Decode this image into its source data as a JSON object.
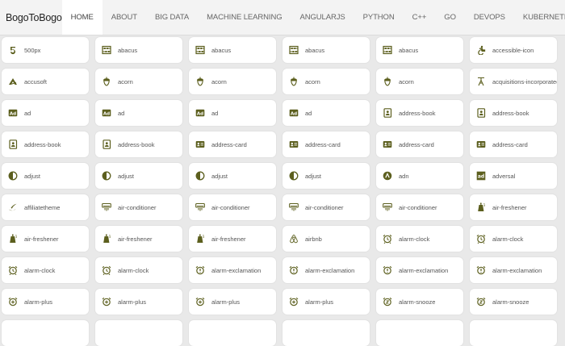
{
  "brand": "BogoToBogo",
  "nav": [
    {
      "label": "HOME",
      "active": true
    },
    {
      "label": "ABOUT"
    },
    {
      "label": "BIG DATA"
    },
    {
      "label": "MACHINE LEARNING"
    },
    {
      "label": "ANGULARJS"
    },
    {
      "label": "PYTHON"
    },
    {
      "label": "C++"
    },
    {
      "label": "GO"
    },
    {
      "label": "DEVOPS"
    },
    {
      "label": "KUBERNETES"
    }
  ],
  "icon_color": "#5c5f1e",
  "icons": [
    {
      "label": "500px",
      "icon": "500px-icon"
    },
    {
      "label": "abacus",
      "icon": "abacus-icon"
    },
    {
      "label": "abacus",
      "icon": "abacus-icon"
    },
    {
      "label": "abacus",
      "icon": "abacus-icon"
    },
    {
      "label": "abacus",
      "icon": "abacus-icon"
    },
    {
      "label": "accessible-icon",
      "icon": "accessible-icon"
    },
    {
      "label": "accusoft",
      "icon": "accusoft-icon"
    },
    {
      "label": "acorn",
      "icon": "acorn-icon"
    },
    {
      "label": "acorn",
      "icon": "acorn-icon"
    },
    {
      "label": "acorn",
      "icon": "acorn-icon"
    },
    {
      "label": "acorn",
      "icon": "acorn-icon"
    },
    {
      "label": "acquisitions-incorporated",
      "icon": "acquisitions-incorporated-icon"
    },
    {
      "label": "ad",
      "icon": "ad-icon"
    },
    {
      "label": "ad",
      "icon": "ad-icon"
    },
    {
      "label": "ad",
      "icon": "ad-icon"
    },
    {
      "label": "ad",
      "icon": "ad-icon"
    },
    {
      "label": "address-book",
      "icon": "address-book-icon"
    },
    {
      "label": "address-book",
      "icon": "address-book-icon"
    },
    {
      "label": "address-book",
      "icon": "address-book-icon"
    },
    {
      "label": "address-book",
      "icon": "address-book-icon"
    },
    {
      "label": "address-card",
      "icon": "address-card-icon"
    },
    {
      "label": "address-card",
      "icon": "address-card-icon"
    },
    {
      "label": "address-card",
      "icon": "address-card-icon"
    },
    {
      "label": "address-card",
      "icon": "address-card-icon"
    },
    {
      "label": "adjust",
      "icon": "adjust-icon"
    },
    {
      "label": "adjust",
      "icon": "adjust-icon"
    },
    {
      "label": "adjust",
      "icon": "adjust-icon"
    },
    {
      "label": "adjust",
      "icon": "adjust-icon"
    },
    {
      "label": "adn",
      "icon": "adn-icon"
    },
    {
      "label": "adversal",
      "icon": "adversal-icon"
    },
    {
      "label": "affiliatetheme",
      "icon": "affiliatetheme-icon"
    },
    {
      "label": "air-conditioner",
      "icon": "air-conditioner-icon"
    },
    {
      "label": "air-conditioner",
      "icon": "air-conditioner-icon"
    },
    {
      "label": "air-conditioner",
      "icon": "air-conditioner-icon"
    },
    {
      "label": "air-conditioner",
      "icon": "air-conditioner-icon"
    },
    {
      "label": "air-freshener",
      "icon": "air-freshener-icon"
    },
    {
      "label": "air-freshener",
      "icon": "air-freshener-icon"
    },
    {
      "label": "air-freshener",
      "icon": "air-freshener-icon"
    },
    {
      "label": "air-freshener",
      "icon": "air-freshener-icon"
    },
    {
      "label": "airbnb",
      "icon": "airbnb-icon"
    },
    {
      "label": "alarm-clock",
      "icon": "alarm-clock-icon"
    },
    {
      "label": "alarm-clock",
      "icon": "alarm-clock-icon"
    },
    {
      "label": "alarm-clock",
      "icon": "alarm-clock-icon"
    },
    {
      "label": "alarm-clock",
      "icon": "alarm-clock-icon"
    },
    {
      "label": "alarm-exclamation",
      "icon": "alarm-exclamation-icon"
    },
    {
      "label": "alarm-exclamation",
      "icon": "alarm-exclamation-icon"
    },
    {
      "label": "alarm-exclamation",
      "icon": "alarm-exclamation-icon"
    },
    {
      "label": "alarm-exclamation",
      "icon": "alarm-exclamation-icon"
    },
    {
      "label": "alarm-plus",
      "icon": "alarm-plus-icon"
    },
    {
      "label": "alarm-plus",
      "icon": "alarm-plus-icon"
    },
    {
      "label": "alarm-plus",
      "icon": "alarm-plus-icon"
    },
    {
      "label": "alarm-plus",
      "icon": "alarm-plus-icon"
    },
    {
      "label": "alarm-snooze",
      "icon": "alarm-snooze-icon"
    },
    {
      "label": "alarm-snooze",
      "icon": "alarm-snooze-icon"
    },
    {
      "label": "",
      "icon": ""
    },
    {
      "label": "",
      "icon": ""
    },
    {
      "label": "",
      "icon": ""
    },
    {
      "label": "",
      "icon": ""
    },
    {
      "label": "",
      "icon": ""
    },
    {
      "label": "",
      "icon": ""
    }
  ]
}
